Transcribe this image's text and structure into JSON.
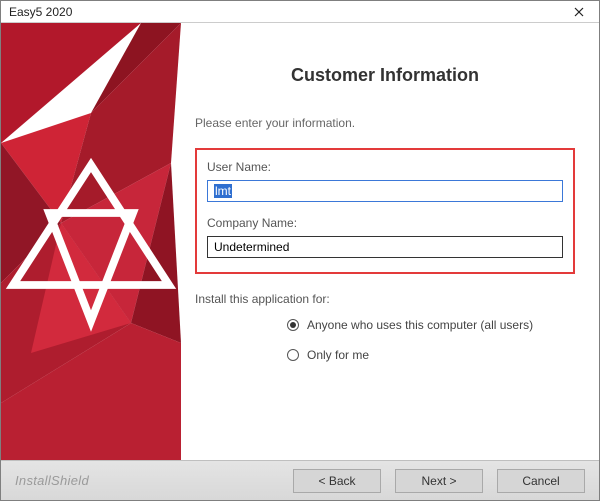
{
  "window": {
    "title": "Easy5 2020"
  },
  "header": {
    "title": "Customer Information"
  },
  "form": {
    "instructions": "Please enter your information.",
    "username_label": "User Name:",
    "username_value": "lmt",
    "company_label": "Company Name:",
    "company_value": "Undetermined",
    "install_for_label": "Install this application for:",
    "radio_all_users": "Anyone who uses this computer (all users)",
    "radio_only_me": "Only for me"
  },
  "footer": {
    "brand": "InstallShield",
    "back": "< Back",
    "next": "Next >",
    "cancel": "Cancel"
  }
}
